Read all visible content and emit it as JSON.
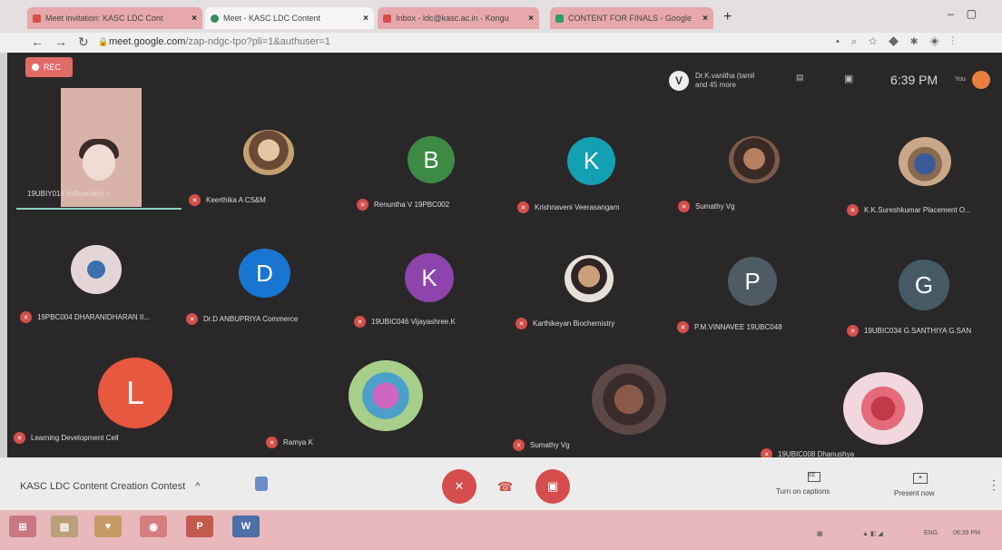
{
  "tabs": [
    {
      "title": "Meet invitation: KASC LDC Cont"
    },
    {
      "title": "Meet - KASC LDC Content"
    },
    {
      "title": "Inbox - ldc@kasc.ac.in - Kongu"
    },
    {
      "title": "CONTENT FOR FINALS - Google"
    }
  ],
  "address": {
    "domain": "meet.google.com",
    "path": "/zap-ndgc-tpo?pli=1&authuser=1"
  },
  "meet": {
    "rec_label": "REC",
    "host": {
      "initial": "V",
      "line1": "Dr.K.vanitha (tamil",
      "line2": "and 45 more"
    },
    "time": "6:39 PM",
    "you_label": "You",
    "self_name": "19UBIY014 Indhumathy I"
  },
  "participants": [
    {
      "name": "Keerthika A CS&M",
      "type": "photo"
    },
    {
      "name": "Renuntha V 19PBC002",
      "initial": "B",
      "color": "#3d8a44"
    },
    {
      "name": "Krishnaveni Veerasangam",
      "initial": "K",
      "color": "#14a0b3"
    },
    {
      "name": "Sumathy Vg",
      "type": "photo"
    },
    {
      "name": "K.K.Sureshkumar Placement O...",
      "type": "photo"
    },
    {
      "name": "19PBC004 DHARANIDHARAN II...",
      "type": "photo"
    },
    {
      "name": "Dr.D ANBUPRIYA Commerce",
      "initial": "D",
      "color": "#1876d2"
    },
    {
      "name": "19UBIC046 Vijayashree.K",
      "initial": "K",
      "color": "#8e44ad"
    },
    {
      "name": "Karthikeyan Biochemistry",
      "type": "photo"
    },
    {
      "name": "P.M.VINNAVEE 19UBC048",
      "initial": "P",
      "color": "#4f5b62"
    },
    {
      "name": "19UBIC034 G.SANTHIYA G.SAN",
      "initial": "G",
      "color": "#455a64"
    },
    {
      "name": "Learning Development Cell",
      "initial": "L",
      "color": "#e8573f"
    },
    {
      "name": "Ramya K",
      "type": "photo"
    },
    {
      "name": "Sumathy Vg",
      "type": "photo"
    },
    {
      "name": "19UBIC008 Dhanushya",
      "type": "photo"
    }
  ],
  "bottom": {
    "meeting_title": "KASC LDC Content Creation Contest",
    "captions_label": "Turn on captions",
    "present_label": "Present now"
  },
  "taskbar": {
    "lang": "ENG",
    "time": "06:39 PM"
  }
}
